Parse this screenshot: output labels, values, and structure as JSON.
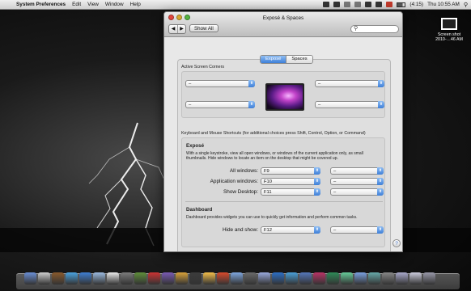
{
  "menubar": {
    "app": "System Preferences",
    "items": [
      "Edit",
      "View",
      "Window",
      "Help"
    ],
    "battery": "(4:15)",
    "clock": "Thu 10:55 AM"
  },
  "desktop_item": {
    "line1": "Screen shot",
    "line2": "2010-…46 AM"
  },
  "window": {
    "title": "Exposé & Spaces",
    "show_all": "Show All",
    "back_glyph": "◀",
    "forward_glyph": "▶",
    "search_placeholder": "",
    "tabs": [
      {
        "label": "Exposé",
        "active": true
      },
      {
        "label": "Spaces",
        "active": false
      }
    ],
    "corners_label": "Active Screen Corners",
    "corners": {
      "top_left": "–",
      "top_right": "–",
      "bottom_left": "–",
      "bottom_right": "–"
    },
    "shortcuts_label": "Keyboard and Mouse Shortcuts (for additional choices press Shift, Control, Option, or Command)",
    "expose_heading": "Exposé",
    "expose_desc": "With a single keystroke, view all open windows, or windows of the current application only, as small thumbnails. Hide windows to locate an item on the desktop that might be covered up.",
    "rows": [
      {
        "label": "All windows:",
        "key": "F9",
        "mouse": "–"
      },
      {
        "label": "Application windows:",
        "key": "F10",
        "mouse": "–"
      },
      {
        "label": "Show Desktop:",
        "key": "F11",
        "mouse": "–"
      }
    ],
    "dashboard_heading": "Dashboard",
    "dashboard_desc": "Dashboard provides widgets you can use to quickly get information and perform common tasks.",
    "dashboard_row": {
      "label": "Hide and show:",
      "key": "F12",
      "mouse": "–"
    },
    "help": "?"
  },
  "dock_colors": [
    "#6a8fd6",
    "#cfcfcf",
    "#8a5a2c",
    "#4aa3e0",
    "#3f7fd2",
    "#9bbbe0",
    "#eaeaea",
    "#7c7c7c",
    "#5f8f3a",
    "#c33",
    "#7a5bb5",
    "#d8a23a",
    "#3c3c3c",
    "#f5c04a",
    "#d94a2c",
    "#7fa7e0",
    "#6a6a6a",
    "#9ad",
    "#2c6fc7",
    "#4aa0d8",
    "#57b",
    "#b36",
    "#2e8b57",
    "#6c9",
    "#7aa0e0",
    "#6aa",
    "#888",
    "#aac",
    "#ccd",
    "#99a"
  ]
}
